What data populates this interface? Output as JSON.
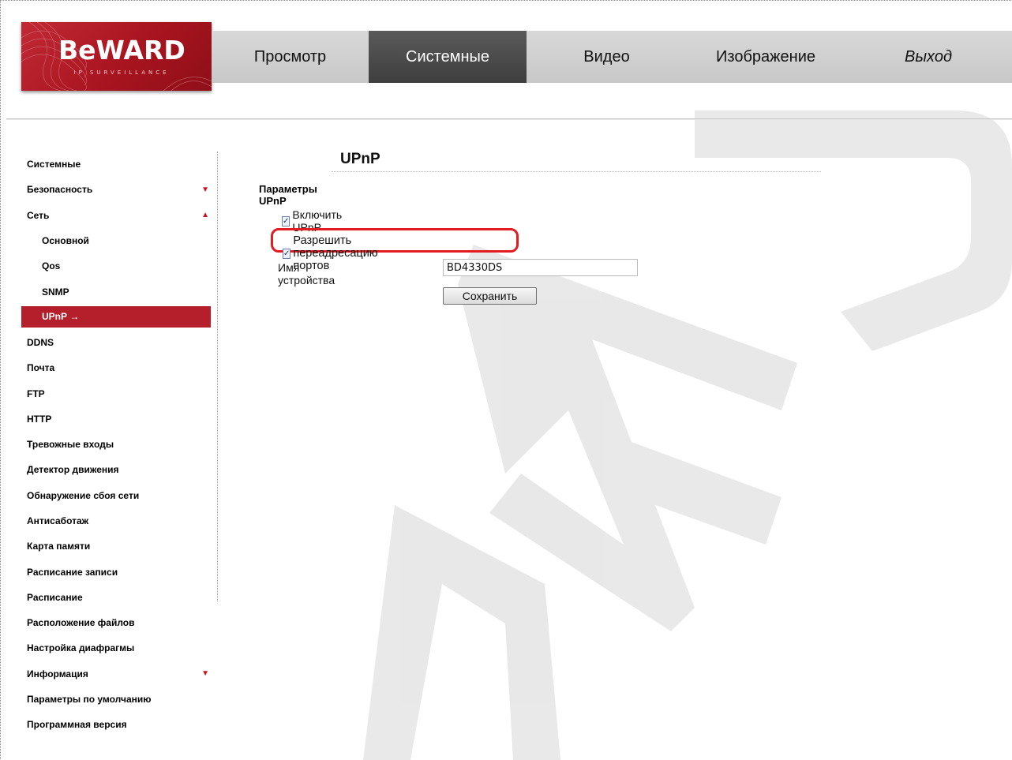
{
  "brand": {
    "logo_text": "BeWARD",
    "logo_subtext": "IP SURVEILLANCE"
  },
  "nav": {
    "items": [
      {
        "label": "Просмотр",
        "active": false
      },
      {
        "label": "Системные",
        "active": true
      },
      {
        "label": "Видео",
        "active": false
      },
      {
        "label": "Изображение",
        "active": false
      },
      {
        "label": "Выход",
        "active": false
      }
    ]
  },
  "sidebar": {
    "items": [
      {
        "label": "Системные",
        "level": 0
      },
      {
        "label": "Безопасность",
        "level": 0,
        "arrow": "▼"
      },
      {
        "label": "Сеть",
        "level": 0,
        "arrow": "▲"
      },
      {
        "label": "Основной",
        "level": 1
      },
      {
        "label": "Qos",
        "level": 1
      },
      {
        "label": "SNMP",
        "level": 1
      },
      {
        "label": "UPnP",
        "level": 1,
        "active": true,
        "suffix": "→"
      },
      {
        "label": "DDNS",
        "level": 0
      },
      {
        "label": "Почта",
        "level": 0
      },
      {
        "label": "FTP",
        "level": 0
      },
      {
        "label": "HTTP",
        "level": 0
      },
      {
        "label": "Тревожные входы",
        "level": 0
      },
      {
        "label": "Детектор движения",
        "level": 0
      },
      {
        "label": "Обнаружение сбоя сети",
        "level": 0
      },
      {
        "label": "Антисаботаж",
        "level": 0
      },
      {
        "label": "Карта памяти",
        "level": 0
      },
      {
        "label": "Расписание записи",
        "level": 0
      },
      {
        "label": "Расписание",
        "level": 0
      },
      {
        "label": "Расположение файлов",
        "level": 0
      },
      {
        "label": "Настройка диафрагмы",
        "level": 0
      },
      {
        "label": "Информация",
        "level": 0,
        "arrow": "▼"
      },
      {
        "label": "Параметры по умолчанию",
        "level": 0
      },
      {
        "label": "Программная версия",
        "level": 0
      }
    ]
  },
  "main": {
    "title": "UPnP",
    "section_title": "Параметры UPnP",
    "enable_upnp": {
      "label": "Включить UPnP",
      "checked": true
    },
    "port_forwarding": {
      "label": "Разрешить переадресацию портов",
      "checked": true
    },
    "device_name": {
      "label": "Имя устройства",
      "value": "BD4330DS"
    },
    "save_label": "Сохранить",
    "check_glyph": "✓"
  },
  "colors": {
    "brand_red": "#b51f2b",
    "highlight_red": "#e21c22",
    "nav_active": "#4a4a4a"
  }
}
